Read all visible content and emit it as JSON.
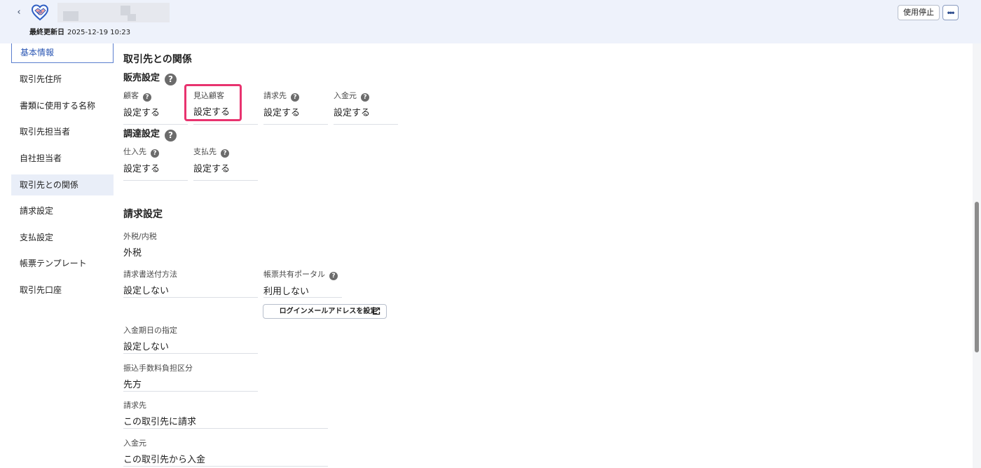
{
  "header": {
    "back_label": "‹",
    "updated_label": "最終更新日",
    "updated_value": "2025-12-19 10:23",
    "stop_button": "使用停止",
    "more_button": "•••"
  },
  "sidebar": {
    "items": [
      {
        "label": "基本情報"
      },
      {
        "label": "取引先住所"
      },
      {
        "label": "書類に使用する名称"
      },
      {
        "label": "取引先担当者"
      },
      {
        "label": "自社担当者"
      },
      {
        "label": "取引先との関係"
      },
      {
        "label": "請求設定"
      },
      {
        "label": "支払設定"
      },
      {
        "label": "帳票テンプレート"
      },
      {
        "label": "取引先口座"
      }
    ],
    "active_index": 5
  },
  "relation": {
    "title": "取引先との関係",
    "sales": {
      "title": "販売設定",
      "fields": [
        {
          "label": "顧客",
          "value": "設定する",
          "help": true
        },
        {
          "label": "見込顧客",
          "value": "設定する",
          "help": false
        },
        {
          "label": "請求先",
          "value": "設定する",
          "help": true
        },
        {
          "label": "入金元",
          "value": "設定する",
          "help": true
        }
      ]
    },
    "procurement": {
      "title": "調達設定",
      "fields": [
        {
          "label": "仕入先",
          "value": "設定する",
          "help": true
        },
        {
          "label": "支払先",
          "value": "設定する",
          "help": true
        }
      ]
    }
  },
  "billing": {
    "title": "請求設定",
    "tax_label": "外税/内税",
    "tax_value": "外税",
    "send_label": "請求書送付方法",
    "send_value": "設定しない",
    "portal_label": "帳票共有ポータル",
    "portal_value": "利用しない",
    "portal_button": "ログインメールアドレスを設定",
    "due_label": "入金期日の指定",
    "due_value": "設定しない",
    "fee_label": "振込手数料負担区分",
    "fee_value": "先方",
    "bill_to_label": "請求先",
    "bill_to_value": "この取引先に請求",
    "payer_label": "入金元",
    "payer_value": "この取引先から入金"
  },
  "colors": {
    "header_bg": "#eef2fb",
    "accent": "#2a56b3",
    "highlight": "#e8336f"
  }
}
